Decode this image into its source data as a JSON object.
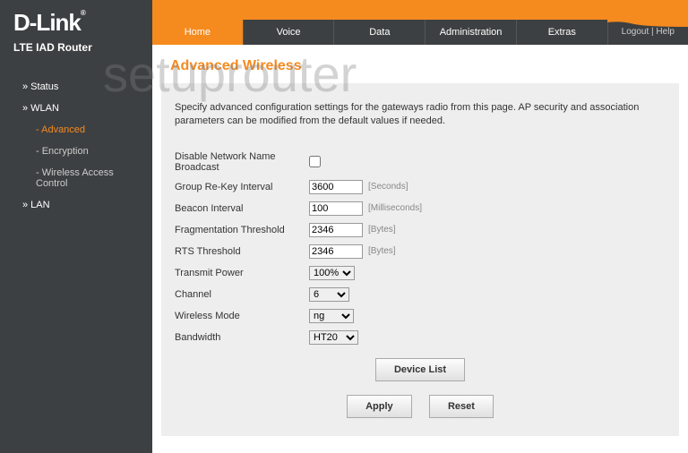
{
  "brand": "D-Link",
  "brand_suffix": "®",
  "product": "LTE IAD Router",
  "watermark": "setuprouter",
  "nav": [
    {
      "label": "» Status",
      "sub": false,
      "active": false
    },
    {
      "label": "» WLAN",
      "sub": false,
      "active": false
    },
    {
      "label": "- Advanced",
      "sub": true,
      "active": true
    },
    {
      "label": "- Encryption",
      "sub": true,
      "active": false
    },
    {
      "label": "- Wireless Access Control",
      "sub": true,
      "active": false
    },
    {
      "label": "» LAN",
      "sub": false,
      "active": false
    }
  ],
  "tabs": [
    {
      "label": "Home",
      "active": true
    },
    {
      "label": "Voice",
      "active": false
    },
    {
      "label": "Data",
      "active": false
    },
    {
      "label": "Administration",
      "active": false
    },
    {
      "label": "Extras",
      "active": false
    }
  ],
  "top_links": {
    "logout": "Logout",
    "sep": " | ",
    "help": "Help"
  },
  "page_title": "Advanced Wireless",
  "description": "Specify advanced configuration settings for the gateways radio from this page. AP security and association parameters can be modified from the default values if needed.",
  "fields": {
    "disable_bcast": {
      "label": "Disable Network Name Broadcast",
      "checked": false
    },
    "rekey": {
      "label": "Group Re-Key Interval",
      "value": "3600",
      "unit": "[Seconds]"
    },
    "beacon": {
      "label": "Beacon Interval",
      "value": "100",
      "unit": "[Milliseconds]"
    },
    "frag": {
      "label": "Fragmentation Threshold",
      "value": "2346",
      "unit": "[Bytes]"
    },
    "rts": {
      "label": "RTS Threshold",
      "value": "2346",
      "unit": "[Bytes]"
    },
    "txpower": {
      "label": "Transmit Power",
      "value": "100%"
    },
    "channel": {
      "label": "Channel",
      "value": "6"
    },
    "mode": {
      "label": "Wireless Mode",
      "value": "ng"
    },
    "bandwidth": {
      "label": "Bandwidth",
      "value": "HT20"
    }
  },
  "buttons": {
    "device_list": "Device List",
    "apply": "Apply",
    "reset": "Reset"
  }
}
